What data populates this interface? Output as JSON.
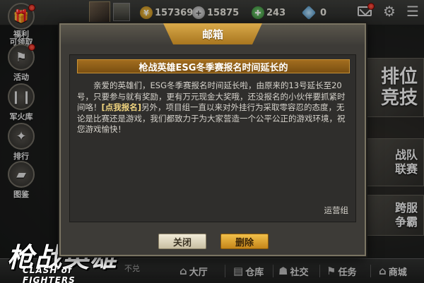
{
  "topbar": {
    "resources": {
      "gold": "157369",
      "silver": "15875",
      "green": "243",
      "diamond": "0"
    },
    "icons": {
      "gold": "gold-coin-icon",
      "silver": "silver-coin-icon",
      "green": "green-resource-icon",
      "diamond": "diamond-icon",
      "mail": "mail-icon",
      "settings": "gear-icon"
    }
  },
  "sidebar": {
    "items": [
      {
        "label": "福利\n可领取",
        "icon": "gift-icon"
      },
      {
        "label": "活动",
        "icon": "flag-icon"
      },
      {
        "label": "军火库",
        "icon": "ammo-icon"
      },
      {
        "label": "排行",
        "icon": "ranking-icon"
      },
      {
        "label": "图鉴",
        "icon": "gun-icon"
      }
    ]
  },
  "right_panels": {
    "ranked": "排位\n竞技",
    "clan": "战队\n联赛",
    "cross_server": "跨服\n争霸"
  },
  "bottom_nav": {
    "items": [
      {
        "label": "大厅",
        "icon": "home-icon"
      },
      {
        "label": "仓库",
        "icon": "warehouse-icon"
      },
      {
        "label": "社交",
        "icon": "chat-icon"
      },
      {
        "label": "任务",
        "icon": "flag-icon"
      },
      {
        "label": "商城",
        "icon": "shop-icon"
      }
    ],
    "partial_text": "不兑"
  },
  "logo": {
    "cn": "枪战英雄",
    "en": "CLASH of FIGHTERS"
  },
  "modal": {
    "tab_title": "邮箱",
    "mail_title": "枪战英雄ESG冬季赛报名时间延长的",
    "body_before_link": "亲爱的英雄们，ESG冬季赛报名时间延长啦，由原来的13号延长至20号，只要参与就有奖励，更有万元现金大奖哦，还没报名的小伙伴要抓紧时间咯！",
    "link_text": "[点我报名]",
    "body_after_link": "另外，项目组一直以来对外挂行为采取零容忍的态度，无论是比赛还是游戏，我们都致力于为大家营造一个公平公正的游戏环境，祝您游戏愉快！",
    "signature": "运营组",
    "close_label": "关闭",
    "delete_label": "删除"
  }
}
